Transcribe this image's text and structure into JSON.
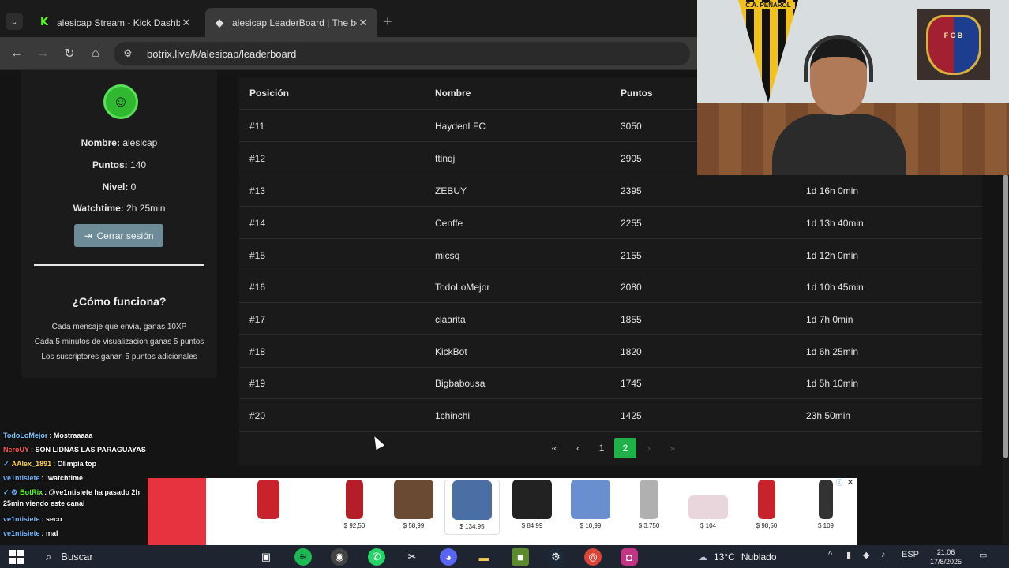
{
  "browser": {
    "tabs": [
      {
        "title": "alesicap Stream - Kick Dashboa",
        "favicon": "K"
      },
      {
        "title": "alesicap LeaderBoard | The best",
        "favicon": "◆"
      }
    ],
    "url": "botrix.live/k/alesicap/leaderboard"
  },
  "profile": {
    "nombre_label": "Nombre:",
    "nombre_value": "alesicap",
    "puntos_label": "Puntos:",
    "puntos_value": "140",
    "nivel_label": "Nivel:",
    "nivel_value": "0",
    "watchtime_label": "Watchtime:",
    "watchtime_value": "2h 25min",
    "logout_label": "Cerrar sesión",
    "how_title": "¿Cómo funciona?",
    "how_lines": [
      "Cada mensaje que envia, ganas 10XP",
      "Cada 5 minutos de visualizacion ganas 5 puntos",
      "Los suscriptores ganan 5 puntos adicionales"
    ]
  },
  "leaderboard": {
    "headers": [
      "Posición",
      "Nombre",
      "Puntos"
    ],
    "rows": [
      {
        "pos": "#11",
        "name": "HaydenLFC",
        "points": "3050",
        "watchtime": ""
      },
      {
        "pos": "#12",
        "name": "ttinqj",
        "points": "2905",
        "watchtime": ""
      },
      {
        "pos": "#13",
        "name": "ZEBUY",
        "points": "2395",
        "watchtime": "1d 16h 0min"
      },
      {
        "pos": "#14",
        "name": "Cenffe",
        "points": "2255",
        "watchtime": "1d 13h 40min"
      },
      {
        "pos": "#15",
        "name": "micsq",
        "points": "2155",
        "watchtime": "1d 12h 0min"
      },
      {
        "pos": "#16",
        "name": "TodoLoMejor",
        "points": "2080",
        "watchtime": "1d 10h 45min"
      },
      {
        "pos": "#17",
        "name": "claarita",
        "points": "1855",
        "watchtime": "1d 7h 0min"
      },
      {
        "pos": "#18",
        "name": "KickBot",
        "points": "1820",
        "watchtime": "1d 6h 25min"
      },
      {
        "pos": "#19",
        "name": "Bigbabousa",
        "points": "1745",
        "watchtime": "1d 5h 10min"
      },
      {
        "pos": "#20",
        "name": "1chinchi",
        "points": "1425",
        "watchtime": "23h 50min"
      }
    ],
    "pagination": {
      "first": "«",
      "prev": "‹",
      "pages": [
        "1",
        "2"
      ],
      "current": "2",
      "next": "›",
      "last": "»"
    }
  },
  "webcam": {
    "pennant_text": "C.A. PEÑAROL",
    "crest_text": "F C B"
  },
  "chat": [
    {
      "user": "TodoLoMejor",
      "color": "#7ec8ff",
      "text": ": Mostraaaaa",
      "badge": ""
    },
    {
      "user": "NeroUY",
      "color": "#ff5a5a",
      "text": ": SON LIDNAS LAS PARAGUAYAS",
      "badge": ""
    },
    {
      "user": "AAlex_1891",
      "color": "#ffd24a",
      "text": ": Olimpia top",
      "badge": "✓"
    },
    {
      "user": "ve1ntisiete",
      "color": "#6fb6ff",
      "text": ": !watchtime",
      "badge": ""
    },
    {
      "user": "BotRix",
      "color": "#53fc18",
      "text": ": @ve1ntisiete ha pasado 2h",
      "badge": "✓ ⚙"
    },
    {
      "user": "",
      "color": "#ffffff",
      "text": "25min viendo este canal",
      "badge": ""
    },
    {
      "user": "ve1ntisiete",
      "color": "#6fb6ff",
      "text": ": seco",
      "badge": ""
    },
    {
      "user": "ve1ntisiete",
      "color": "#6fb6ff",
      "text": ": mal",
      "badge": ""
    }
  ],
  "ads": [
    {
      "price": "",
      "color": "#c8232c"
    },
    {
      "price": "$ 92,50",
      "color": "#b51e28"
    },
    {
      "price": "$ 58,99",
      "color": "#6b4a33"
    },
    {
      "price": "$ 134,95",
      "color": "#4a6fa5"
    },
    {
      "price": "$ 84,99",
      "color": "#222222"
    },
    {
      "price": "$ 10,99",
      "color": "#6a8fd0"
    },
    {
      "price": "$ 3.750",
      "color": "#b0b0b0"
    },
    {
      "price": "$ 104",
      "color": "#e8d6dc"
    },
    {
      "price": "$ 98,50",
      "color": "#c8232c"
    },
    {
      "price": "$ 109",
      "color": "#333333"
    }
  ],
  "taskbar": {
    "search_placeholder": "Buscar",
    "weather_temp": "13°C",
    "weather_text": "Nublado",
    "lang": "ESP",
    "time": "21:06",
    "date": "17/8/2025"
  }
}
